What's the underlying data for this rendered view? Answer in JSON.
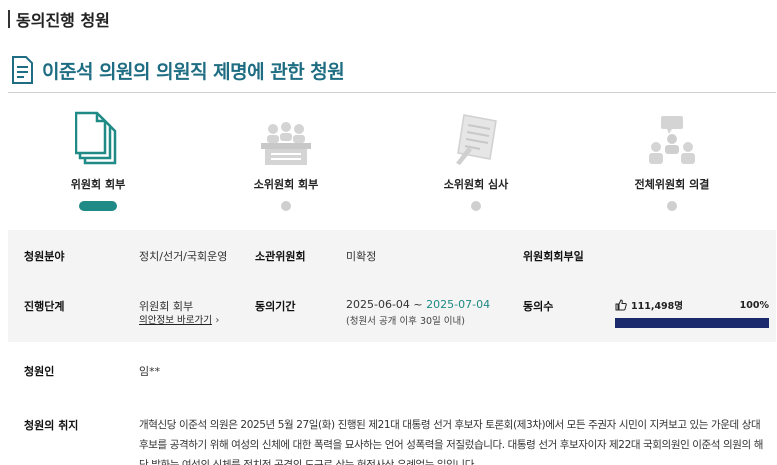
{
  "section": {
    "title": "동의진행 청원"
  },
  "petition": {
    "title": "이준석 의원의 의원직 제명에 관한 청원"
  },
  "steps": [
    {
      "label": "위원회 회부",
      "icon": "documents-icon",
      "active": true
    },
    {
      "label": "소위원회 회부",
      "icon": "meeting-icon",
      "active": false
    },
    {
      "label": "소위원회 심사",
      "icon": "review-icon",
      "active": false
    },
    {
      "label": "전체위원회 의결",
      "icon": "assembly-icon",
      "active": false
    }
  ],
  "info": {
    "field_label": "청원분야",
    "field_value": "정치/선거/국회운영",
    "committee_label": "소관위원회",
    "committee_value": "미확정",
    "referral_date_label": "위원회회부일",
    "referral_date_value": "",
    "stage_label": "진행단계",
    "stage_value": "위원회 회부",
    "stage_link": "의안정보 바로가기",
    "period_label": "동의기간",
    "period_start": "2025-06-04 ~",
    "period_end": "2025-07-04",
    "period_note": "(청원서 공개 이후 30일 이내)",
    "consent_label": "동의수",
    "consent_count": "111,498명",
    "consent_percent_text": "100%",
    "consent_ratio": 1.0
  },
  "petitioner": {
    "label": "청원인",
    "value": "임**"
  },
  "purpose": {
    "label": "청원의 취지",
    "text": "개혁신당 이준석 의원은 2025년 5월 27일(화) 진행된 제21대 대통령 선거 후보자 토론회(제3차)에서 모든 주권자 시민이 지켜보고 있는 가운데 상대 후보를 공격하기 위해 여성의 신체에 대한 폭력을 묘사하는 언어 성폭력을 저질렀습니다. 대통령 선거 후보자이자 제22대 국회의원인 이준석 의원의 해당 발화는 여성의 신체를 정치적 공격의 도구로 삼는 헌정사상 유례없는 일입니다."
  },
  "colors": {
    "accent": "#1f8a86",
    "title": "#1f6d82",
    "progress": "#1a2a6c",
    "inactive": "#cfcfcf"
  }
}
